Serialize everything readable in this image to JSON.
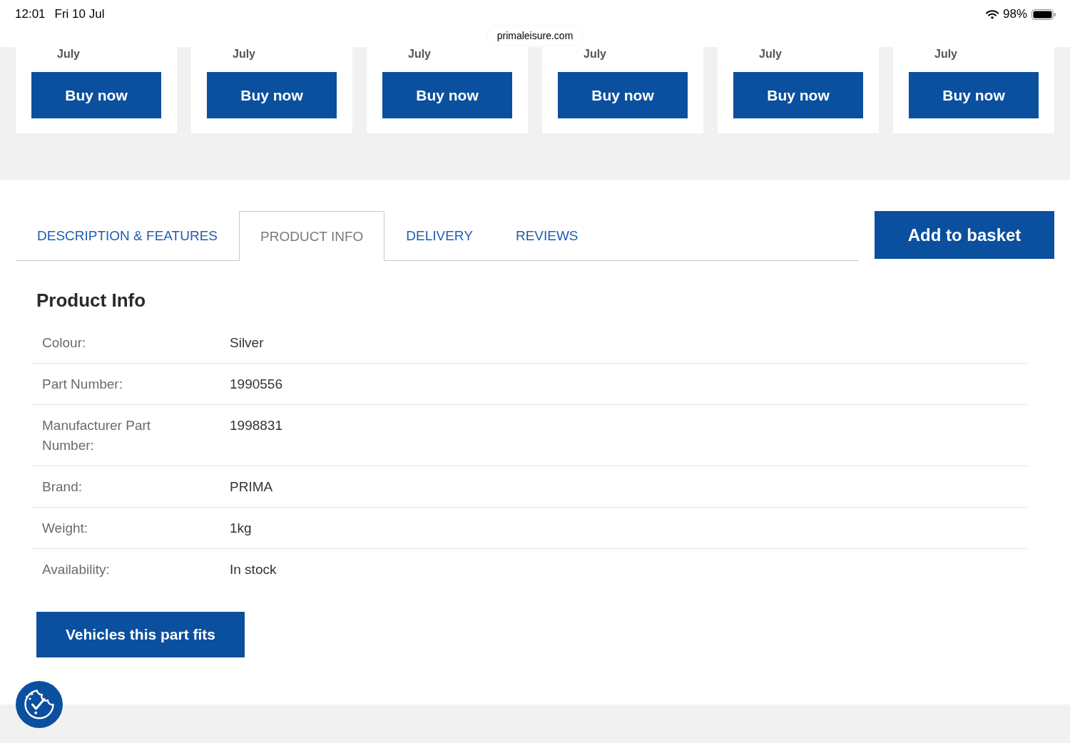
{
  "status_bar": {
    "time": "12:01",
    "date": "Fri 10 Jul",
    "url": "primaleisure.com",
    "battery": "98%"
  },
  "product_cards": [
    {
      "delivery_text": "July",
      "button": "Buy now"
    },
    {
      "delivery_text": "July",
      "button": "Buy now"
    },
    {
      "delivery_text": "July",
      "button": "Buy now"
    },
    {
      "delivery_text": "July",
      "button": "Buy now"
    },
    {
      "delivery_text": "July",
      "button": "Buy now"
    },
    {
      "delivery_text": "July",
      "button": "Buy now"
    }
  ],
  "tabs": [
    {
      "label": "DESCRIPTION & FEATURES",
      "selected": false
    },
    {
      "label": "PRODUCT INFO",
      "selected": true
    },
    {
      "label": "DELIVERY",
      "selected": false
    },
    {
      "label": "REVIEWS",
      "selected": false
    }
  ],
  "add_to_basket": "Add to basket",
  "product_info": {
    "title": "Product Info",
    "rows": [
      {
        "label": "Colour:",
        "value": "Silver"
      },
      {
        "label": "Part Number:",
        "value": "1990556"
      },
      {
        "label": "Manufacturer Part Number:",
        "value": "1998831"
      },
      {
        "label": "Brand:",
        "value": "PRIMA"
      },
      {
        "label": "Weight:",
        "value": "1kg"
      },
      {
        "label": "Availability:",
        "value": "In stock"
      }
    ]
  },
  "vehicles_button": "Vehicles this part fits"
}
